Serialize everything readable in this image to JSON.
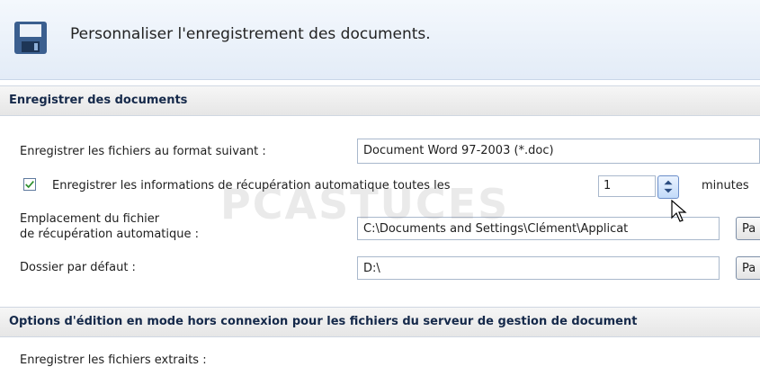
{
  "header": {
    "title": "Personnaliser l'enregistrement des documents.",
    "icon": "floppy-disk-icon"
  },
  "sections": {
    "save_documents": "Enregistrer des documents",
    "offline_editing": "Options d'édition en mode hors connexion pour les fichiers du serveur de gestion de document"
  },
  "form": {
    "format_label": "Enregistrer les fichiers au format suivant :",
    "format_value": "Document Word 97-2003 (*.doc)",
    "autorecover_label": "Enregistrer les informations de récupération automatique toutes les",
    "autorecover_checked": true,
    "autorecover_minutes": "1",
    "minutes_label": "minutes",
    "autorecover_location_label_1": "Emplacement du fichier",
    "autorecover_location_label_2": "de récupération automatique :",
    "autorecover_location_value": "C:\\Documents and Settings\\Clément\\Applicat",
    "default_folder_label": "Dossier par défaut :",
    "default_folder_value": "D:\\",
    "browse_label": "Pa",
    "checked_out_label": "Enregistrer les fichiers extraits :"
  },
  "watermark": "PCASTUCES",
  "colors": {
    "accent": "#15294a",
    "header_bg": "#e3ecf7"
  }
}
